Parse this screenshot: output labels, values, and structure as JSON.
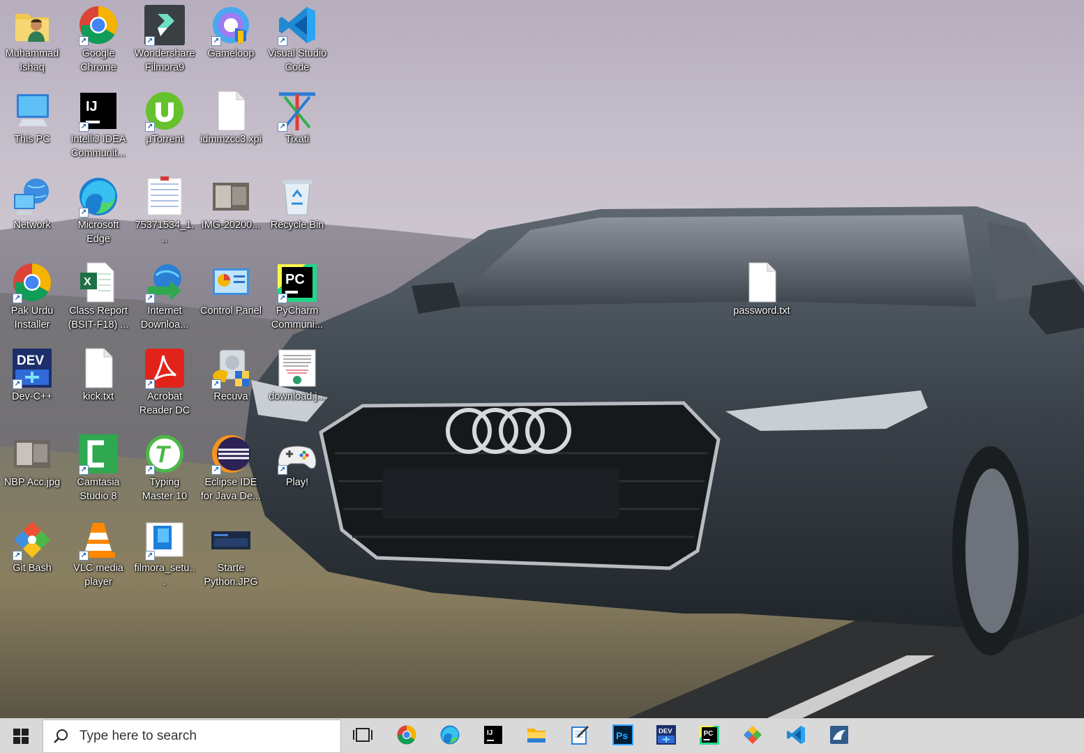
{
  "desktop": {
    "icons": [
      {
        "name": "user-folder",
        "label": "Muhammad Ishaq",
        "glyph": "user-folder-icon",
        "shortcut": false
      },
      {
        "name": "google-chrome",
        "label": "Google Chrome",
        "glyph": "chrome-icon",
        "shortcut": true
      },
      {
        "name": "wondershare-filmora9",
        "label": "Wondershare Filmora9",
        "glyph": "filmora-icon",
        "shortcut": true
      },
      {
        "name": "gameloop",
        "label": "Gameloop",
        "glyph": "gameloop-icon",
        "shortcut": true
      },
      {
        "name": "visual-studio-code",
        "label": "Visual Studio Code",
        "glyph": "vscode-icon",
        "shortcut": true
      },
      {
        "name": "this-pc",
        "label": "This PC",
        "glyph": "computer-icon",
        "shortcut": false
      },
      {
        "name": "intellij-idea",
        "label": "IntelliJ IDEA Communit...",
        "glyph": "intellij-icon",
        "shortcut": true
      },
      {
        "name": "utorrent",
        "label": "µTorrent",
        "glyph": "utorrent-icon",
        "shortcut": true
      },
      {
        "name": "idmmzcc3-xpi",
        "label": "idmmzcc3.xpi",
        "glyph": "blank-file-icon",
        "shortcut": false
      },
      {
        "name": "tixati",
        "label": "Tixati",
        "glyph": "tixati-icon",
        "shortcut": true
      },
      {
        "name": "network",
        "label": "Network",
        "glyph": "network-icon",
        "shortcut": false
      },
      {
        "name": "microsoft-edge",
        "label": "Microsoft Edge",
        "glyph": "edge-icon",
        "shortcut": true
      },
      {
        "name": "image-75371534",
        "label": "75371534_1...",
        "glyph": "image-thumbnail-icon",
        "shortcut": false
      },
      {
        "name": "img-20200",
        "label": "IMG-20200...",
        "glyph": "photo-thumbnail-icon",
        "shortcut": false
      },
      {
        "name": "recycle-bin",
        "label": "Recycle Bin",
        "glyph": "recycle-bin-icon",
        "shortcut": false
      },
      {
        "name": "pak-urdu-installer",
        "label": "Pak Urdu Installer",
        "glyph": "chrome-icon",
        "shortcut": true
      },
      {
        "name": "class-report",
        "label": "Class Report (BSIT-F18) ...",
        "glyph": "excel-icon",
        "shortcut": false
      },
      {
        "name": "internet-download-manager",
        "label": "Internet Downloa...",
        "glyph": "idm-icon",
        "shortcut": true
      },
      {
        "name": "control-panel",
        "label": "Control Panel",
        "glyph": "control-panel-icon",
        "shortcut": false
      },
      {
        "name": "pycharm",
        "label": "PyCharm Communi...",
        "glyph": "pycharm-icon",
        "shortcut": true
      },
      {
        "name": "dev-cpp",
        "label": "Dev-C++",
        "glyph": "devcpp-icon",
        "shortcut": true
      },
      {
        "name": "kick-txt",
        "label": "kick.txt",
        "glyph": "blank-file-icon",
        "shortcut": false
      },
      {
        "name": "acrobat-reader",
        "label": "Acrobat Reader DC",
        "glyph": "acrobat-icon",
        "shortcut": true
      },
      {
        "name": "recuva",
        "label": "Recuva",
        "glyph": "recuva-icon",
        "shortcut": true
      },
      {
        "name": "download-jpg",
        "label": "download.j...",
        "glyph": "document-thumbnail-icon",
        "shortcut": false
      },
      {
        "name": "nbp-acc-jpg",
        "label": "NBP Acc.jpg",
        "glyph": "photo-thumbnail-icon",
        "shortcut": false
      },
      {
        "name": "camtasia",
        "label": "Camtasia Studio 8",
        "glyph": "camtasia-icon",
        "shortcut": true
      },
      {
        "name": "typing-master",
        "label": "Typing Master 10",
        "glyph": "typingmaster-icon",
        "shortcut": true
      },
      {
        "name": "eclipse-ide",
        "label": "Eclipse IDE for Java De...",
        "glyph": "eclipse-icon",
        "shortcut": true
      },
      {
        "name": "play",
        "label": "Play!",
        "glyph": "gamepad-icon",
        "shortcut": true
      },
      {
        "name": "git-bash",
        "label": "Git Bash",
        "glyph": "git-icon",
        "shortcut": true
      },
      {
        "name": "vlc",
        "label": "VLC media player",
        "glyph": "vlc-icon",
        "shortcut": true
      },
      {
        "name": "filmora-setup",
        "label": "filmora_setu...",
        "glyph": "installer-icon",
        "shortcut": true
      },
      {
        "name": "starte-python",
        "label": "Starte Python.JPG",
        "glyph": "screenshot-thumbnail-icon",
        "shortcut": false
      },
      {
        "name": "password-txt",
        "label": "password.txt",
        "glyph": "blank-file-icon",
        "shortcut": false
      }
    ]
  },
  "taskbar": {
    "search_placeholder": "Type here to search",
    "pinned": [
      {
        "name": "task-view",
        "glyph": "task-view-icon"
      },
      {
        "name": "chrome",
        "glyph": "chrome-icon"
      },
      {
        "name": "edge",
        "glyph": "edge-icon"
      },
      {
        "name": "intellij",
        "glyph": "intellij-icon"
      },
      {
        "name": "file-explorer",
        "glyph": "folder-icon"
      },
      {
        "name": "notepad",
        "glyph": "notepad-icon"
      },
      {
        "name": "photoshop",
        "glyph": "photoshop-icon"
      },
      {
        "name": "devcpp",
        "glyph": "devcpp-icon"
      },
      {
        "name": "pycharm",
        "glyph": "pycharm-icon"
      },
      {
        "name": "paint-app",
        "glyph": "color-diamond-icon"
      },
      {
        "name": "vscode",
        "glyph": "vscode-icon"
      },
      {
        "name": "mysql-workbench",
        "glyph": "mysql-workbench-icon"
      }
    ]
  },
  "colors": {
    "taskbar_bg": "#dad9d9",
    "label_text": "#ffffff",
    "shortcut_arrow": "#1d5fb4"
  }
}
